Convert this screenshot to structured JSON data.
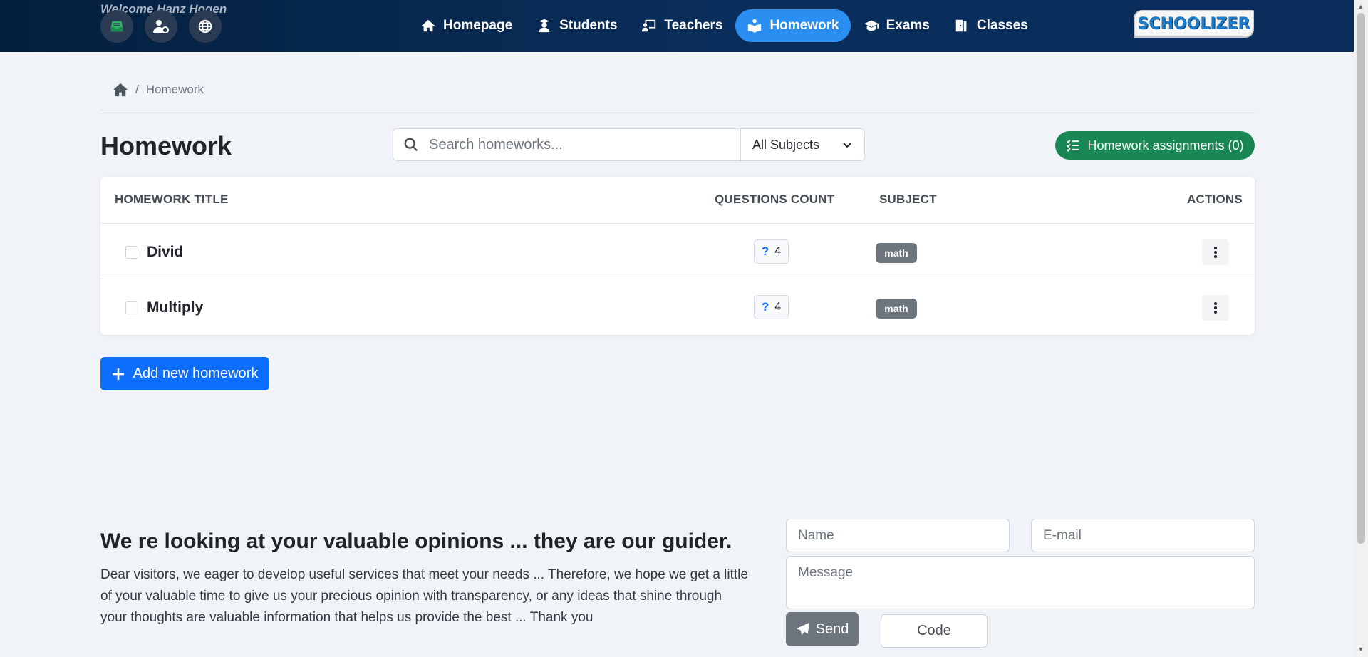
{
  "header": {
    "welcome": "Welcome Hanz Hogen",
    "nav": [
      {
        "label": "Homepage",
        "icon": "home-icon"
      },
      {
        "label": "Students",
        "icon": "student-icon"
      },
      {
        "label": "Teachers",
        "icon": "teacher-icon"
      },
      {
        "label": "Homework",
        "icon": "homework-icon",
        "active": true
      },
      {
        "label": "Exams",
        "icon": "graduation-cap-icon"
      },
      {
        "label": "Classes",
        "icon": "door-icon"
      }
    ],
    "logo_text": "SCHOOLIZER"
  },
  "breadcrumb": {
    "current": "Homework",
    "separator": "/"
  },
  "page": {
    "title": "Homework",
    "search_placeholder": "Search homeworks...",
    "subject_filter": "All Subjects",
    "assignments_button": "Homework assignments (0)"
  },
  "table": {
    "headers": {
      "title": "HOMEWORK TITLE",
      "questions": "QUESTIONS COUNT",
      "subject": "SUBJECT",
      "actions": "ACTIONS"
    },
    "rows": [
      {
        "title": "Divid",
        "questions_icon": "?",
        "questions": "4",
        "subject": "math"
      },
      {
        "title": "Multiply",
        "questions_icon": "?",
        "questions": "4",
        "subject": "math"
      }
    ]
  },
  "add_button": "Add new homework",
  "feedback": {
    "title": "We re looking at your valuable opinions ... they are our guider.",
    "text": "Dear visitors, we eager to develop useful services that meet your needs ... Therefore, we hope we get a little of your valuable time to give us your precious opinion with transparency, or any ideas that shine through your thoughts are valuable information that helps us provide the best ... Thank you",
    "name_placeholder": "Name",
    "email_placeholder": "E-mail",
    "message_placeholder": "Message",
    "send_label": "Send",
    "code_label": "Code"
  },
  "colors": {
    "navbar": "#0a2d5b",
    "active_nav": "#2a8ff0",
    "primary": "#0d6efd",
    "success": "#198754",
    "badge": "#6c757d"
  }
}
